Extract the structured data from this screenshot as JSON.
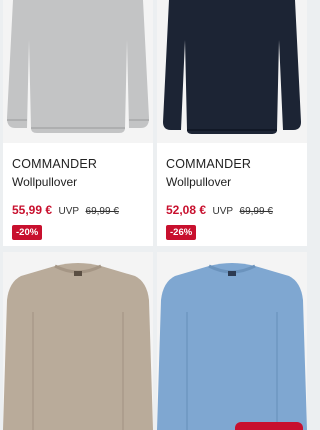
{
  "products": [
    {
      "brand": "COMMANDER",
      "name": "Wollpullover",
      "price": "55,99 €",
      "uvp_label": "UVP",
      "old_price": "69,99 €",
      "discount": "-20%",
      "sweater_color": "#c3c4c5"
    },
    {
      "brand": "COMMANDER",
      "name": "Wollpullover",
      "price": "52,08 €",
      "uvp_label": "UVP",
      "old_price": "69,99 €",
      "discount": "-26%",
      "sweater_color": "#1c2434"
    },
    {
      "sweater_color": "#b9ab9a"
    },
    {
      "sweater_color": "#7fa7d1"
    }
  ],
  "colors": {
    "accent": "#c8102e",
    "background": "#eceff1"
  }
}
